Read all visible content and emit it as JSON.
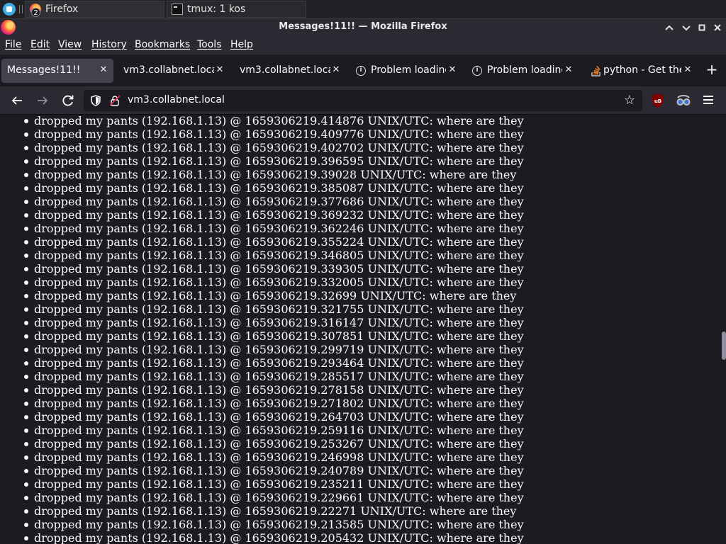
{
  "taskbar": {
    "tasks": [
      {
        "label": "Firefox",
        "badge": "2"
      },
      {
        "label": "tmux: 1 kos"
      }
    ]
  },
  "window": {
    "title": "Messages!11!! — Mozilla Firefox"
  },
  "menu": [
    "File",
    "Edit",
    "View",
    "History",
    "Bookmarks",
    "Tools",
    "Help"
  ],
  "tabs": [
    {
      "label": "Messages!11!!",
      "selected": true
    },
    {
      "label": "vm3.collabnet.local"
    },
    {
      "label": "vm3.collabnet.local"
    },
    {
      "label": "Problem loading page",
      "icon": "info-icon"
    },
    {
      "label": "Problem loading page",
      "icon": "info-icon"
    },
    {
      "label": "python - Get the",
      "icon": "stackoverflow-icon"
    }
  ],
  "nav": {
    "url": "vm3.collabnet.local"
  },
  "messages": [
    "dropped my pants (192.168.1.13) @ 1659306219.414876 UNIX/UTC: where are they",
    "dropped my pants (192.168.1.13) @ 1659306219.409776 UNIX/UTC: where are they",
    "dropped my pants (192.168.1.13) @ 1659306219.402702 UNIX/UTC: where are they",
    "dropped my pants (192.168.1.13) @ 1659306219.396595 UNIX/UTC: where are they",
    "dropped my pants (192.168.1.13) @ 1659306219.39028 UNIX/UTC: where are they",
    "dropped my pants (192.168.1.13) @ 1659306219.385087 UNIX/UTC: where are they",
    "dropped my pants (192.168.1.13) @ 1659306219.377686 UNIX/UTC: where are they",
    "dropped my pants (192.168.1.13) @ 1659306219.369232 UNIX/UTC: where are they",
    "dropped my pants (192.168.1.13) @ 1659306219.362246 UNIX/UTC: where are they",
    "dropped my pants (192.168.1.13) @ 1659306219.355224 UNIX/UTC: where are they",
    "dropped my pants (192.168.1.13) @ 1659306219.346805 UNIX/UTC: where are they",
    "dropped my pants (192.168.1.13) @ 1659306219.339305 UNIX/UTC: where are they",
    "dropped my pants (192.168.1.13) @ 1659306219.332005 UNIX/UTC: where are they",
    "dropped my pants (192.168.1.13) @ 1659306219.32699 UNIX/UTC: where are they",
    "dropped my pants (192.168.1.13) @ 1659306219.321755 UNIX/UTC: where are they",
    "dropped my pants (192.168.1.13) @ 1659306219.316147 UNIX/UTC: where are they",
    "dropped my pants (192.168.1.13) @ 1659306219.307851 UNIX/UTC: where are they",
    "dropped my pants (192.168.1.13) @ 1659306219.299719 UNIX/UTC: where are they",
    "dropped my pants (192.168.1.13) @ 1659306219.293464 UNIX/UTC: where are they",
    "dropped my pants (192.168.1.13) @ 1659306219.285517 UNIX/UTC: where are they",
    "dropped my pants (192.168.1.13) @ 1659306219.278158 UNIX/UTC: where are they",
    "dropped my pants (192.168.1.13) @ 1659306219.271802 UNIX/UTC: where are they",
    "dropped my pants (192.168.1.13) @ 1659306219.264703 UNIX/UTC: where are they",
    "dropped my pants (192.168.1.13) @ 1659306219.259116 UNIX/UTC: where are they",
    "dropped my pants (192.168.1.13) @ 1659306219.253267 UNIX/UTC: where are they",
    "dropped my pants (192.168.1.13) @ 1659306219.246998 UNIX/UTC: where are they",
    "dropped my pants (192.168.1.13) @ 1659306219.240789 UNIX/UTC: where are they",
    "dropped my pants (192.168.1.13) @ 1659306219.235211 UNIX/UTC: where are they",
    "dropped my pants (192.168.1.13) @ 1659306219.229661 UNIX/UTC: where are they",
    "dropped my pants (192.168.1.13) @ 1659306219.22271 UNIX/UTC: where are they",
    "dropped my pants (192.168.1.13) @ 1659306219.213585 UNIX/UTC: where are they",
    "dropped my pants (192.168.1.13) @ 1659306219.205432 UNIX/UTC: where are they"
  ]
}
